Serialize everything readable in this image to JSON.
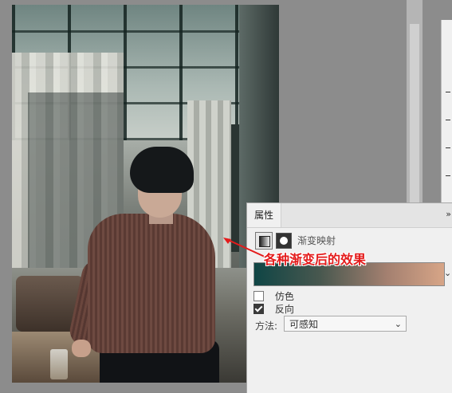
{
  "properties_panel": {
    "tab_label": "属性",
    "collapse_glyph": "»",
    "adjustment_title": "渐变映射",
    "dither_label": "仿色",
    "reverse_label": "反向",
    "method_label": "方法:",
    "method_value": "可感知",
    "dither_checked": false,
    "reverse_checked": true
  },
  "annotation": {
    "text": "各种渐变后的效果",
    "color": "#e41b1b"
  },
  "gradient": {
    "stops": [
      "#0f4545",
      "#49584f",
      "#a48070",
      "#d7a587"
    ]
  },
  "icons": {
    "gradient_map": "gradient-map-icon",
    "mask": "mask-icon",
    "dropdown": "chevron-down-icon"
  }
}
